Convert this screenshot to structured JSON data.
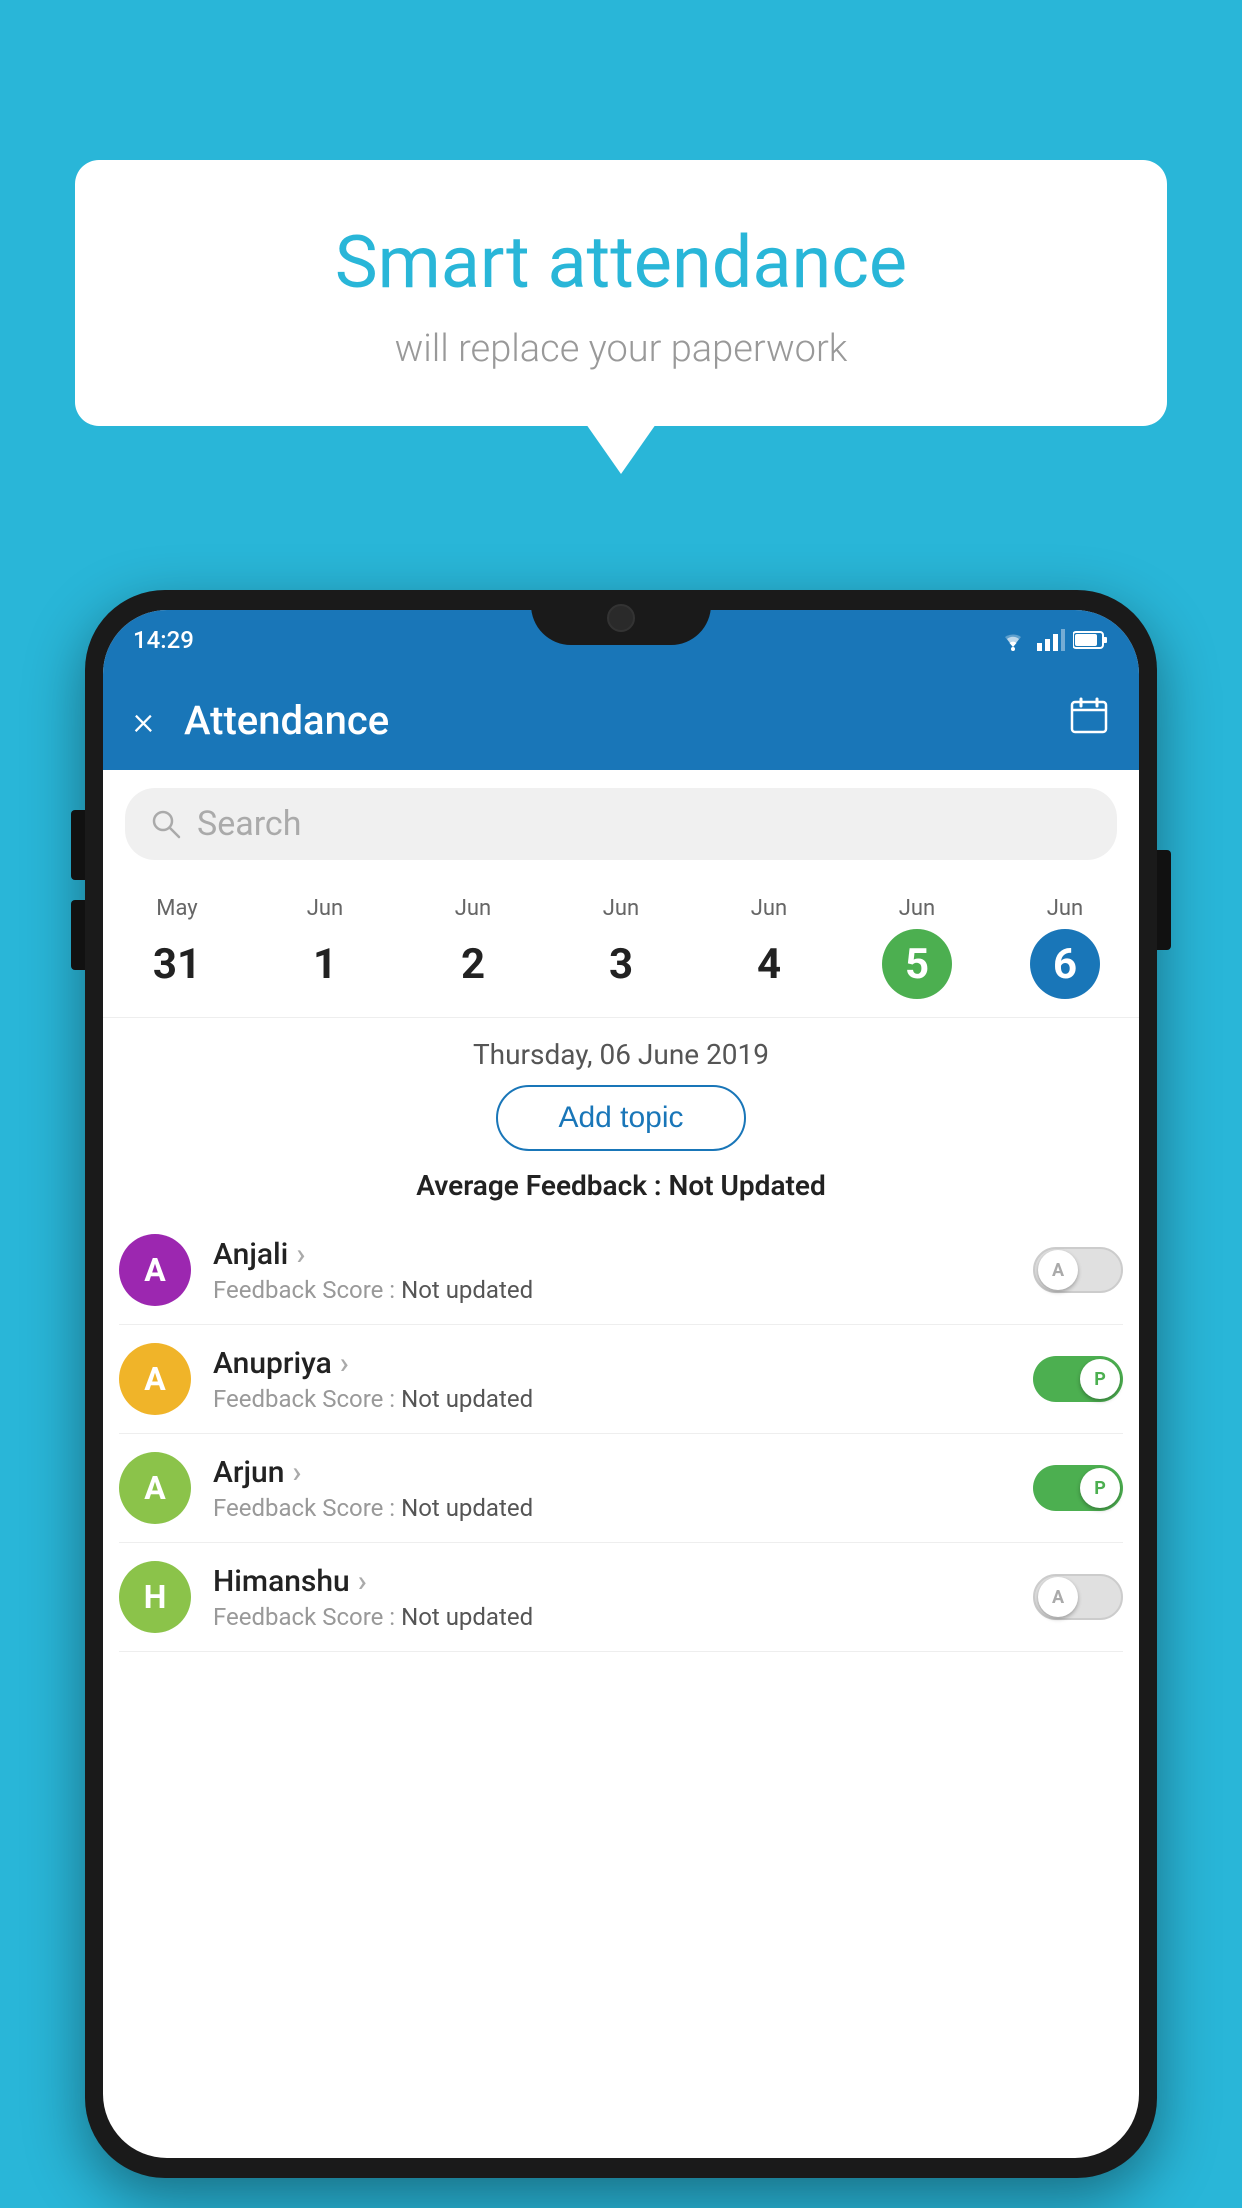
{
  "background_color": "#29b6d8",
  "bubble": {
    "title": "Smart attendance",
    "subtitle": "will replace your paperwork"
  },
  "status_bar": {
    "time": "14:29",
    "wifi": "wifi-icon",
    "signal": "signal-icon",
    "battery": "battery-icon"
  },
  "app_bar": {
    "title": "Attendance",
    "close_label": "×",
    "calendar_label": "📅"
  },
  "search": {
    "placeholder": "Search"
  },
  "calendar": {
    "days": [
      {
        "month": "May",
        "date": "31",
        "state": "normal"
      },
      {
        "month": "Jun",
        "date": "1",
        "state": "normal"
      },
      {
        "month": "Jun",
        "date": "2",
        "state": "normal"
      },
      {
        "month": "Jun",
        "date": "3",
        "state": "normal"
      },
      {
        "month": "Jun",
        "date": "4",
        "state": "normal"
      },
      {
        "month": "Jun",
        "date": "5",
        "state": "today"
      },
      {
        "month": "Jun",
        "date": "6",
        "state": "selected"
      }
    ]
  },
  "selected_date": "Thursday, 06 June 2019",
  "add_topic_label": "Add topic",
  "avg_feedback_label": "Average Feedback :",
  "avg_feedback_value": "Not Updated",
  "students": [
    {
      "name": "Anjali",
      "feedback_label": "Feedback Score :",
      "feedback_value": "Not updated",
      "avatar_letter": "A",
      "avatar_color": "#9c27b0",
      "toggle_state": "off",
      "toggle_letter": "A"
    },
    {
      "name": "Anupriya",
      "feedback_label": "Feedback Score :",
      "feedback_value": "Not updated",
      "avatar_letter": "A",
      "avatar_color": "#f0b429",
      "toggle_state": "on",
      "toggle_letter": "P"
    },
    {
      "name": "Arjun",
      "feedback_label": "Feedback Score :",
      "feedback_value": "Not updated",
      "avatar_letter": "A",
      "avatar_color": "#8bc34a",
      "toggle_state": "on",
      "toggle_letter": "P"
    },
    {
      "name": "Himanshu",
      "feedback_label": "Feedback Score :",
      "feedback_value": "Not updated",
      "avatar_letter": "H",
      "avatar_color": "#8bc34a",
      "toggle_state": "off",
      "toggle_letter": "A"
    }
  ]
}
